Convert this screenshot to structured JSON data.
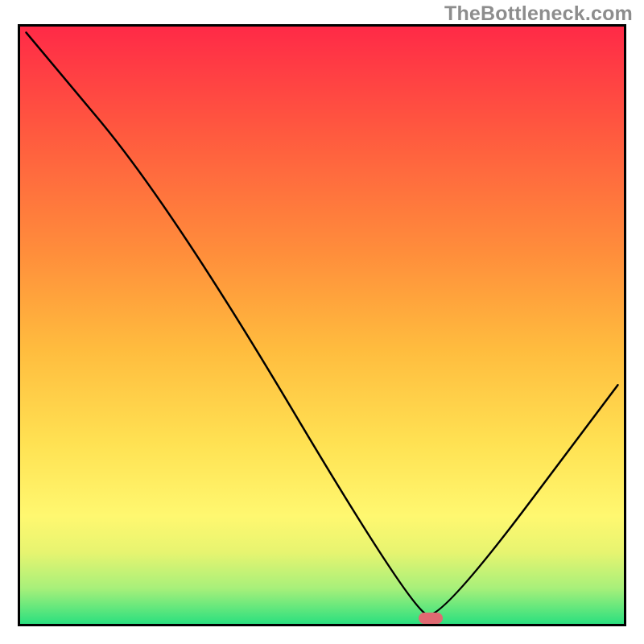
{
  "watermark": "TheBottleneck.com",
  "chart_data": {
    "type": "line",
    "title": "",
    "xlabel": "",
    "ylabel": "",
    "xlim": [
      0,
      100
    ],
    "ylim": [
      0,
      100
    ],
    "series": [
      {
        "name": "curve",
        "x": [
          1,
          25,
          65,
          70,
          99
        ],
        "values": [
          99,
          70,
          2,
          1,
          40
        ]
      }
    ],
    "annotations": [
      {
        "name": "marker",
        "x": 68,
        "y": 1
      }
    ],
    "grid": false,
    "legend": false
  }
}
